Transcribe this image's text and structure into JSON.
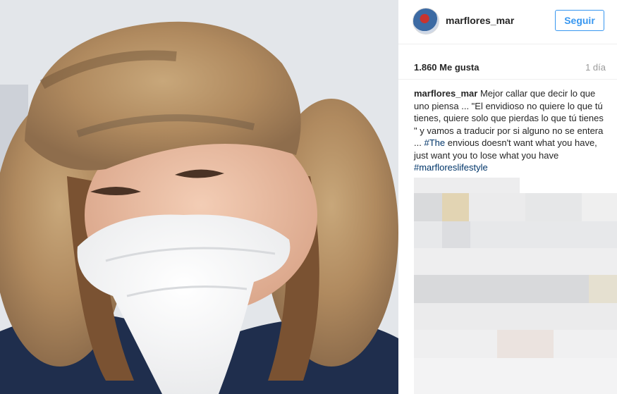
{
  "post": {
    "username": "marflores_mar",
    "follow_label": "Seguir",
    "likes": "1.860 Me gusta",
    "time_ago": "1 día",
    "caption": {
      "username": "marflores_mar",
      "text": "Mejor callar que decir lo que uno piensa ... \"El envidioso no quiere lo que tú tienes, quiere solo que pierdas lo que tú tienes \" y vamos a traducir por si alguno no se entera ...",
      "hashtag1": "#The",
      "text2": "envious doesn't want what you have, just want you to lose what you have",
      "hashtag2": "#marfloreslifestyle"
    }
  },
  "colors": {
    "accent": "#3897f0",
    "hashtag": "#003569",
    "muted": "#999999",
    "text": "#262626"
  },
  "icons": {
    "avatar": "avatar",
    "photo": "woman-in-fur-hat-photo"
  }
}
